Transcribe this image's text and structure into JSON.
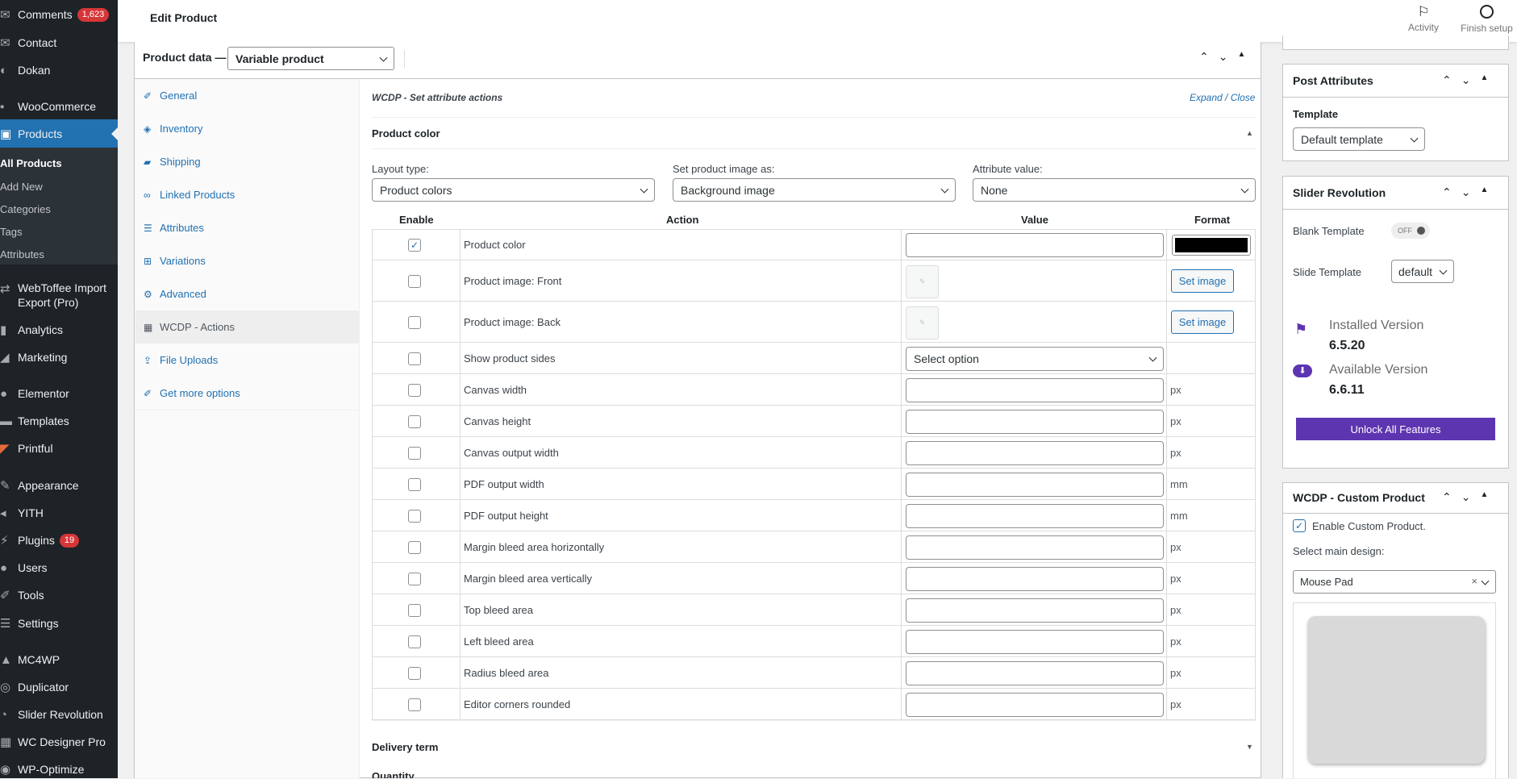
{
  "menu": {
    "comments": "Comments",
    "comments_badge": "1,623",
    "contact": "Contact",
    "dokan": "Dokan",
    "woocommerce": "WooCommerce",
    "products": "Products",
    "all_products": "All Products",
    "add_new": "Add New",
    "categories": "Categories",
    "tags": "Tags",
    "attributes": "Attributes",
    "webtoffee": "WebToffee Import Export (Pro)",
    "analytics": "Analytics",
    "marketing": "Marketing",
    "elementor": "Elementor",
    "templates": "Templates",
    "printful": "Printful",
    "appearance": "Appearance",
    "yith": "YITH",
    "plugins": "Plugins",
    "plugins_badge": "19",
    "users": "Users",
    "tools": "Tools",
    "settings": "Settings",
    "mc4wp": "MC4WP",
    "duplicator": "Duplicator",
    "slider_revolution": "Slider Revolution",
    "wc_designer": "WC Designer Pro",
    "wp_optimize": "WP-Optimize"
  },
  "topbar": {
    "title": "Edit Product",
    "activity": "Activity",
    "finish_setup": "Finish setup"
  },
  "product_data": {
    "label": "Product data —",
    "type": "Variable product"
  },
  "tabs": [
    "General",
    "Inventory",
    "Shipping",
    "Linked Products",
    "Attributes",
    "Variations",
    "Advanced",
    "WCDP - Actions",
    "File Uploads",
    "Get more options"
  ],
  "wcdp": {
    "heading": "WCDP - Set attribute actions",
    "expand": "Expand",
    "sep": "/",
    "close": "Close",
    "section": "Product color",
    "layout_label": "Layout type:",
    "layout_value": "Product colors",
    "image_label": "Set product image as:",
    "image_value": "Background image",
    "attr_label": "Attribute value:",
    "attr_value": "None",
    "col_enable": "Enable",
    "col_action": "Action",
    "col_value": "Value",
    "col_format": "Format",
    "set_image": "Set image",
    "select_option": "Select option",
    "delivery": "Delivery term",
    "quantity": "Quantity"
  },
  "rows": [
    {
      "action": "Product color",
      "checked": true,
      "kind": "color",
      "unit": "",
      "color": "#000000"
    },
    {
      "action": "Product image: Front",
      "checked": false,
      "kind": "image",
      "unit": ""
    },
    {
      "action": "Product image: Back",
      "checked": false,
      "kind": "image",
      "unit": ""
    },
    {
      "action": "Show product sides",
      "checked": false,
      "kind": "select",
      "unit": ""
    },
    {
      "action": "Canvas width",
      "checked": false,
      "kind": "input",
      "unit": "px"
    },
    {
      "action": "Canvas height",
      "checked": false,
      "kind": "input",
      "unit": "px"
    },
    {
      "action": "Canvas output width",
      "checked": false,
      "kind": "input",
      "unit": "px"
    },
    {
      "action": "PDF output width",
      "checked": false,
      "kind": "input",
      "unit": "mm"
    },
    {
      "action": "PDF output height",
      "checked": false,
      "kind": "input",
      "unit": "mm"
    },
    {
      "action": "Margin bleed area horizontally",
      "checked": false,
      "kind": "input",
      "unit": "px"
    },
    {
      "action": "Margin bleed area vertically",
      "checked": false,
      "kind": "input",
      "unit": "px"
    },
    {
      "action": "Top bleed area",
      "checked": false,
      "kind": "input",
      "unit": "px"
    },
    {
      "action": "Left bleed area",
      "checked": false,
      "kind": "input",
      "unit": "px"
    },
    {
      "action": "Radius bleed area",
      "checked": false,
      "kind": "input",
      "unit": "px"
    },
    {
      "action": "Editor corners rounded",
      "checked": false,
      "kind": "input",
      "unit": "px"
    }
  ],
  "post_attributes": {
    "title": "Post Attributes",
    "template_label": "Template",
    "template_value": "Default template"
  },
  "slider_rev": {
    "title": "Slider Revolution",
    "blank_label": "Blank Template",
    "toggle": "OFF",
    "slide_label": "Slide Template",
    "slide_value": "default",
    "installed_label": "Installed Version",
    "installed_value": "6.5.20",
    "available_label": "Available Version",
    "available_value": "6.6.11",
    "unlock": "Unlock All Features"
  },
  "custom_product": {
    "title": "WCDP - Custom Product",
    "enable_label": "Enable Custom Product.",
    "select_label": "Select main design:",
    "design_value": "Mouse Pad",
    "clear": "×"
  },
  "colors": {
    "accent": "#2271b1",
    "sidebar": "#1d2327",
    "active": "#2271b1",
    "badge": "#d63638",
    "purple": "#5e35b1"
  }
}
